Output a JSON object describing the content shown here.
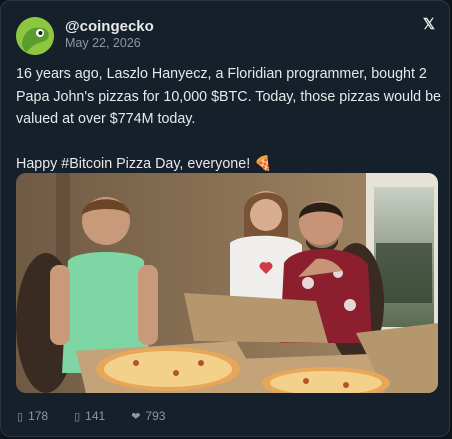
{
  "tweet": {
    "handle": "@coingecko",
    "date": "May 22, 2026",
    "body_line1": "16 years ago, Laszlo Hanyecz, a Floridian programmer, bought 2 Papa John's pizzas for 10,000 $BTC. Today, those pizzas would be valued at over $774M today.",
    "body_line2": "Happy #Bitcoin Pizza Day, everyone! 🍕",
    "close_glyph": "𝕏",
    "photo_alt": "Family photo with two pizzas in boxes on a table"
  },
  "actions": {
    "replies_icon": "comment-icon",
    "replies": "178",
    "retweets_icon": "retweet-icon",
    "retweets": "141",
    "likes_icon": "heart-icon",
    "likes": "793"
  },
  "colors": {
    "background": "#15202b",
    "text": "#e7e9ea",
    "muted": "#8b98a5",
    "brand": "#8dc63f"
  }
}
